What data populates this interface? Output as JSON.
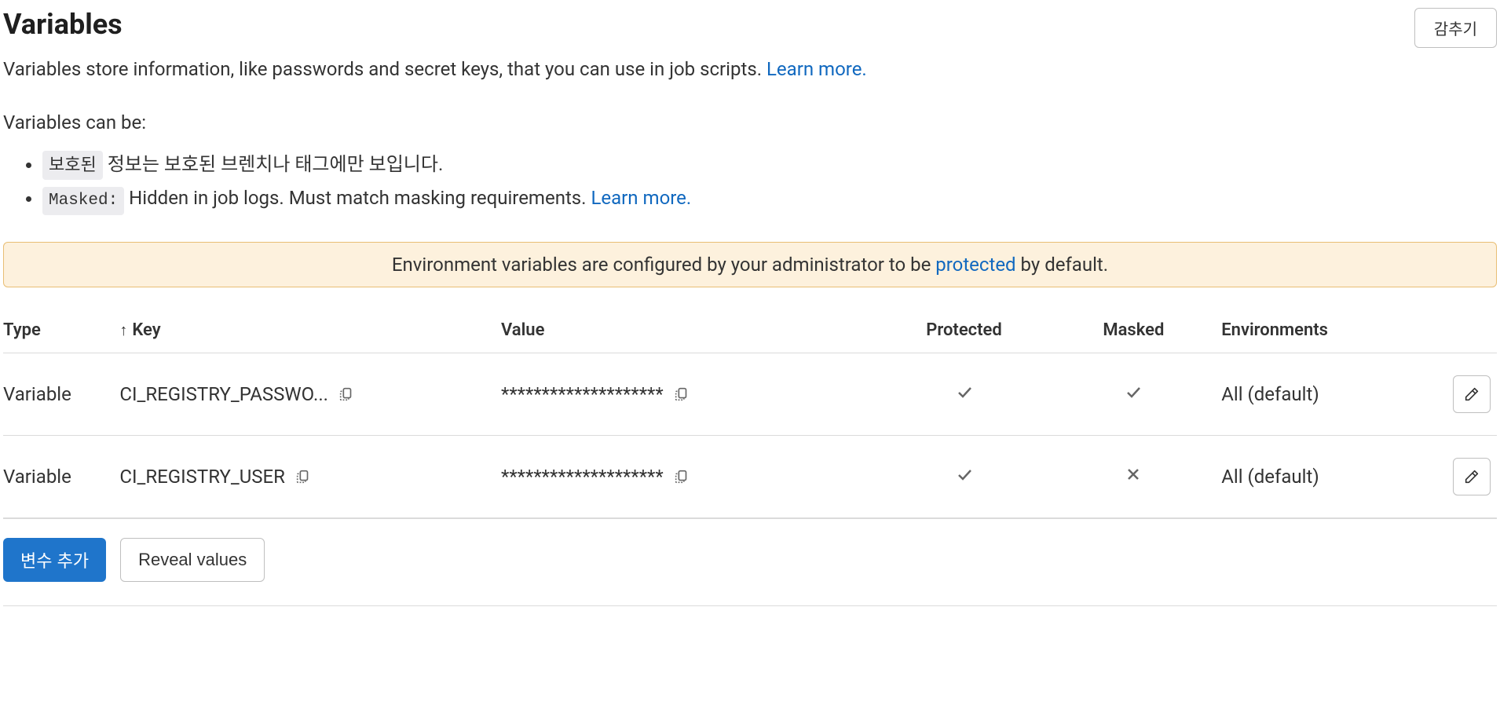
{
  "header": {
    "title": "Variables",
    "hide_button": "감추기"
  },
  "description": {
    "text": "Variables store information, like passwords and secret keys, that you can use in job scripts. ",
    "learn_more": "Learn more."
  },
  "subheading": "Variables can be:",
  "bullets": [
    {
      "tag": "보호된",
      "text": " 정보는 보호된 브렌치나 태그에만 보입니다."
    },
    {
      "tag": "Masked:",
      "text": " Hidden in job logs. Must match masking requirements. ",
      "learn_more": "Learn more."
    }
  ],
  "banner": {
    "before": "Environment variables are configured by your administrator to be ",
    "link": "protected",
    "after": " by default."
  },
  "table": {
    "headers": {
      "type": "Type",
      "key": "Key",
      "value": "Value",
      "protected": "Protected",
      "masked": "Masked",
      "environments": "Environments"
    },
    "rows": [
      {
        "type": "Variable",
        "key": "CI_REGISTRY_PASSWO...",
        "value": "********************",
        "protected": true,
        "masked": true,
        "environments": "All (default)"
      },
      {
        "type": "Variable",
        "key": "CI_REGISTRY_USER",
        "value": "********************",
        "protected": true,
        "masked": false,
        "environments": "All (default)"
      }
    ]
  },
  "buttons": {
    "add": "변수 추가",
    "reveal": "Reveal values"
  }
}
